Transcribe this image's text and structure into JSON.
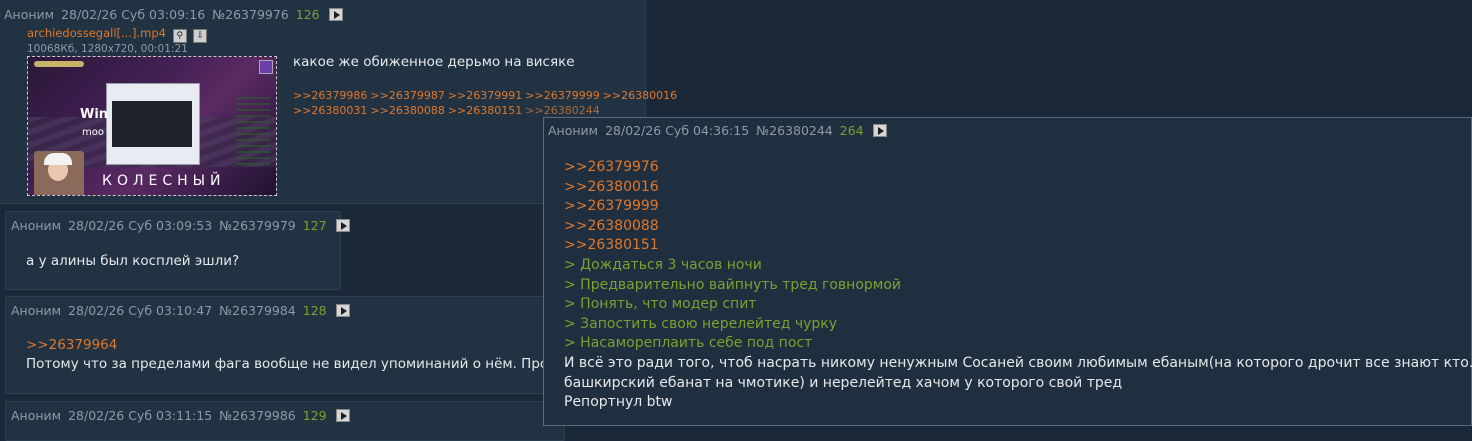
{
  "posts": [
    {
      "name": "Аноним",
      "datetime": "28/02/26 Суб 03:09:16",
      "number": "№26379976",
      "reply_count": "126",
      "file": {
        "name": "archiedossegall[...].mp4",
        "meta": "10068Кб, 1280x720, 00:01:21",
        "thumb_text_1": "Win",
        "thumb_text_2": "moo",
        "thumb_caption": "КОЛЕСНЫЙ"
      },
      "message": "какое же обиженное дерьмо на висяке",
      "replies": [
        ">>26379986",
        ">>26379987",
        ">>26379991",
        ">>26379999",
        ">>26380016",
        ">>26380031",
        ">>26380088",
        ">>26380151",
        ">>26380244"
      ]
    },
    {
      "name": "Аноним",
      "datetime": "28/02/26 Суб 03:09:53",
      "number": "№26379979",
      "reply_count": "127",
      "message": "а у алины был косплей эшли?"
    },
    {
      "name": "Аноним",
      "datetime": "28/02/26 Суб 03:10:47",
      "number": "№26379984",
      "reply_count": "128",
      "quote": ">>26379964",
      "message": "Потому что за пределами фага вообще не видел упоминаний о нём. Прост"
    },
    {
      "name": "Аноним",
      "datetime": "28/02/26 Суб 03:11:15",
      "number": "№26379986",
      "reply_count": "129"
    }
  ],
  "popup": {
    "name": "Аноним",
    "datetime": "28/02/26 Суб 04:36:15",
    "number": "№26380244",
    "reply_count": "264",
    "links": [
      ">>26379976",
      ">>26380016",
      ">>26379999",
      ">>26380088",
      ">>26380151"
    ],
    "greentext": [
      "> Дождаться 3 часов ночи",
      "> Предварительно вайпнуть тред говнормой",
      "> Понять, что модер спит",
      "> Запостить свою нерелейтед чурку",
      "> Насамореплаить себе под пост"
    ],
    "body": [
      "И всё это ради того, чтоб насрать никому ненужным Сосаней своим любимым ебаным(на которого дрочит все знают кто…",
      "башкирский ебанат на чмотике) и нерелейтед хачом у которого свой тред",
      "Репортнул btw"
    ]
  },
  "colors": {
    "background": "#1b2837",
    "post": "#213243",
    "link": "#e0782a",
    "greentext": "#7ca12f",
    "meta": "#8f9aa4"
  }
}
